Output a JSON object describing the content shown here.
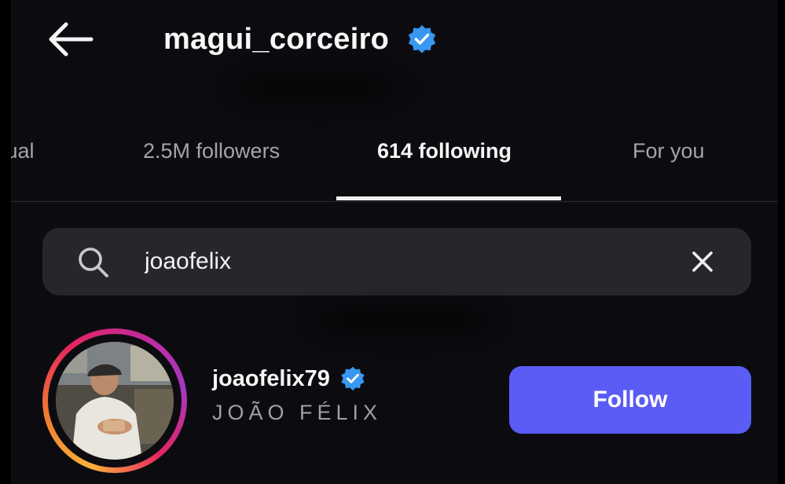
{
  "header": {
    "title": "magui_corceiro",
    "verified": true
  },
  "tabs": [
    {
      "label": "tual",
      "active": false
    },
    {
      "label": "2.5M followers",
      "active": false
    },
    {
      "label": "614 following",
      "active": true
    },
    {
      "label": "For you",
      "active": false
    }
  ],
  "search": {
    "value": "joaofelix"
  },
  "result": {
    "username": "joaofelix79",
    "full_name": "JOÃO FÉLIX",
    "verified": true,
    "button_label": "Follow"
  },
  "colors": {
    "background": "#0c0c10",
    "accent_button": "#5b5cf6",
    "verified_badge": "#3897f0",
    "search_field": "#26272c"
  },
  "icons": {
    "back": "back-arrow-icon",
    "verified": "verified-badge-icon",
    "search": "search-icon",
    "clear": "close-icon"
  }
}
